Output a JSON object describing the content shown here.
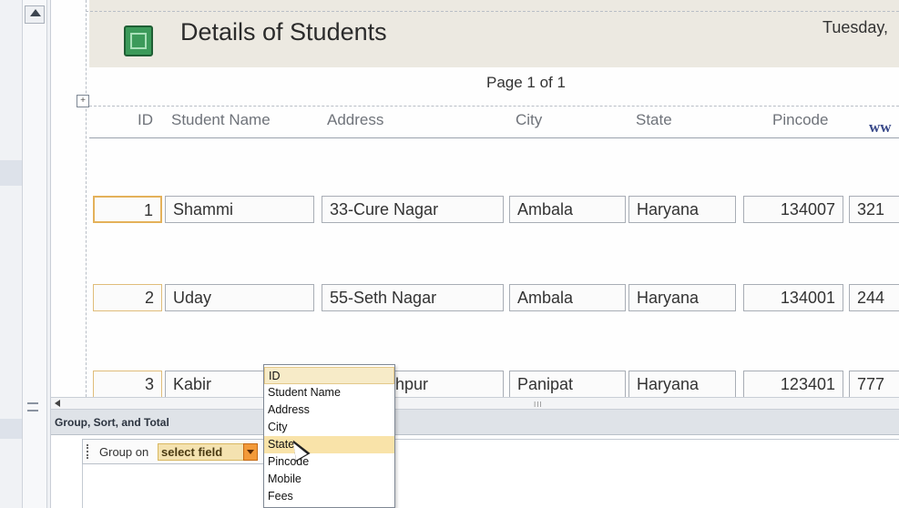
{
  "report": {
    "title": "Details of Students",
    "date_partial": "Tuesday,",
    "page_label": "Page 1 of 1",
    "columns": [
      "ID",
      "Student Name",
      "Address",
      "City",
      "State",
      "Pincode"
    ],
    "watermark_text": "ww",
    "rows": [
      {
        "id": "1",
        "name": "Shammi",
        "address": "33-Cure Nagar",
        "city": "Ambala",
        "state": "Haryana",
        "pincode": "134007",
        "mobile_partial": "321"
      },
      {
        "id": "2",
        "name": "Uday",
        "address": "55-Seth Nagar",
        "city": "Ambala",
        "state": "Haryana",
        "pincode": "134001",
        "mobile_partial": "244"
      },
      {
        "id": "3",
        "name": "Kabir",
        "address": "hpur",
        "city": "Panipat",
        "state": "Haryana",
        "pincode": "123401",
        "mobile_partial": "777"
      }
    ]
  },
  "scrollbar": {
    "thumb_glyph": "III"
  },
  "group_pane": {
    "title": "Group, Sort, and Total",
    "group_on_label": "Group on",
    "select_value": "select field"
  },
  "dropdown": {
    "options": [
      "ID",
      "Student Name",
      "Address",
      "City",
      "State",
      "Pincode",
      "Mobile",
      "Fees"
    ],
    "hovered": "State"
  },
  "colors": {
    "header_band": "#ece9e1",
    "selected_field_border": "#e4b15a",
    "dropdown_button": "#f29a3a",
    "pane_header": "#dfe3e8"
  },
  "icons": {
    "report_icon": "report-icon",
    "scroll_up": "arrow-up-icon",
    "scroll_left": "arrow-left-icon",
    "dropdown_arrow": "chevron-down-icon",
    "cursor": "mouse-pointer-icon"
  }
}
